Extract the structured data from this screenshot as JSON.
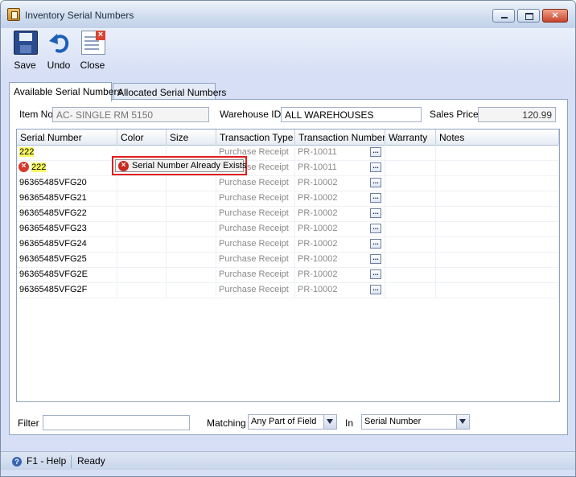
{
  "window": {
    "title": "Inventory Serial Numbers"
  },
  "toolbar": {
    "save_label": "Save",
    "undo_label": "Undo",
    "close_label": "Close"
  },
  "tabs": [
    {
      "label": "Available Serial Numbers",
      "active": true
    },
    {
      "label": "Allocated Serial Numbers",
      "active": false
    }
  ],
  "header": {
    "item_no_label": "Item No",
    "item_no_value": "AC- SINGLE RM 5150",
    "warehouse_label": "Warehouse ID",
    "warehouse_value": "ALL WAREHOUSES",
    "sales_price_label": "Sales Price",
    "sales_price_value": "120.99"
  },
  "grid": {
    "columns": [
      "Serial Number",
      "Color",
      "Size",
      "Transaction Type",
      "Transaction Number",
      "Warranty",
      "Notes"
    ],
    "ellipsis": "...",
    "rows": [
      {
        "serial": "222",
        "type": "Purchase Receipt",
        "number": "PR-10011",
        "highlight": true
      },
      {
        "serial": "222",
        "type": "Purchase Receipt",
        "number": "PR-10011",
        "highlight": true,
        "error": true
      },
      {
        "serial": "96365485VFG20",
        "type": "Purchase Receipt",
        "number": "PR-10002"
      },
      {
        "serial": "96365485VFG21",
        "type": "Purchase Receipt",
        "number": "PR-10002"
      },
      {
        "serial": "96365485VFG22",
        "type": "Purchase Receipt",
        "number": "PR-10002"
      },
      {
        "serial": "96365485VFG23",
        "type": "Purchase Receipt",
        "number": "PR-10002"
      },
      {
        "serial": "96365485VFG24",
        "type": "Purchase Receipt",
        "number": "PR-10002"
      },
      {
        "serial": "96365485VFG25",
        "type": "Purchase Receipt",
        "number": "PR-10002"
      },
      {
        "serial": "96365485VFG2E",
        "type": "Purchase Receipt",
        "number": "PR-10002"
      },
      {
        "serial": "96365485VFG2F",
        "type": "Purchase Receipt",
        "number": "PR-10002"
      }
    ],
    "error_message": "Serial Number Already Exists"
  },
  "filter": {
    "filter_label": "Filter",
    "filter_value": "",
    "matching_label": "Matching",
    "matching_value": "Any Part of Field",
    "in_label": "In",
    "in_value": "Serial Number"
  },
  "status": {
    "help": "F1 - Help",
    "state": "Ready"
  },
  "colors": {
    "highlight": "#fbfb63",
    "error": "#e21d1d",
    "chrome": "#d6dff5"
  }
}
